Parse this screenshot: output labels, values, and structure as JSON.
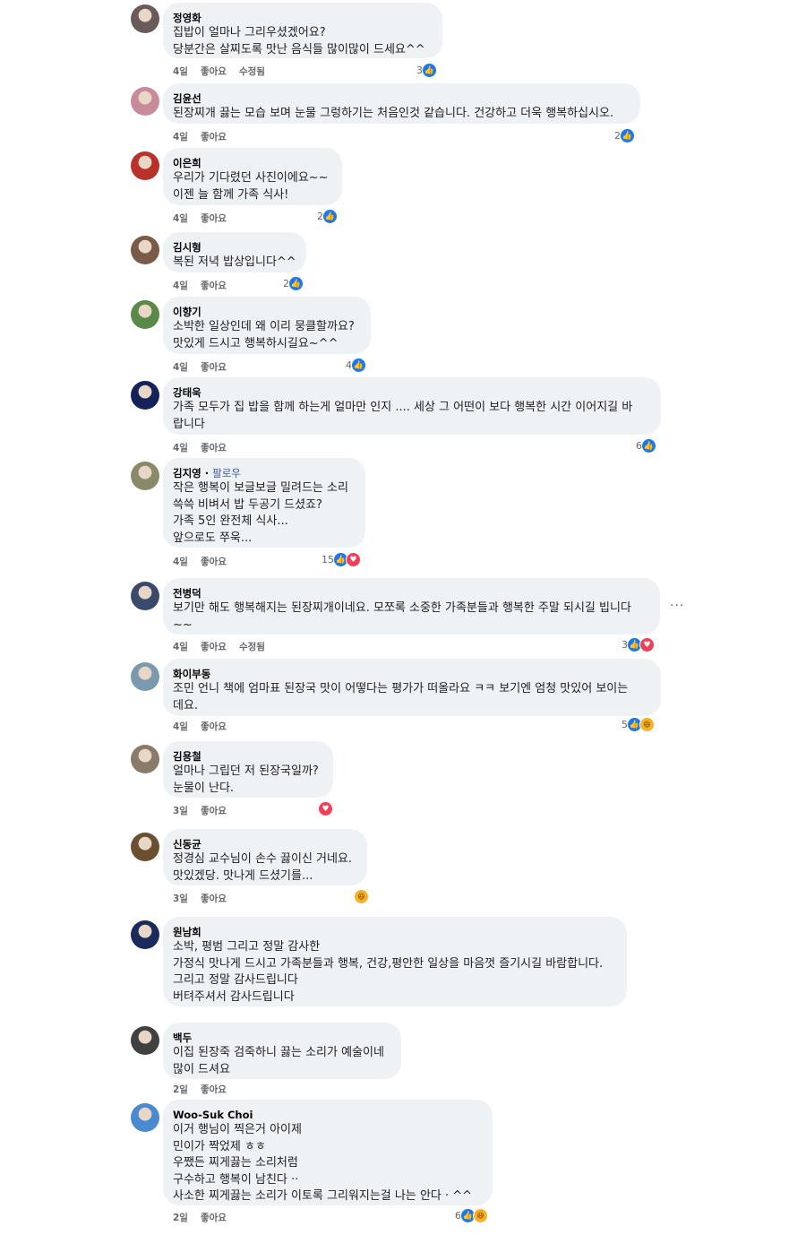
{
  "labels": {
    "like": "좋아요",
    "edited": "수정됨",
    "follow": "팔로우",
    "more": "···"
  },
  "comments": [
    {
      "author": "정영화",
      "lines": [
        "집밥이 얼마나 그리우셨겠어요?",
        "당분간은 살찌도록 맛난 음식들 많이많이 드세요^^"
      ],
      "time": "4일",
      "edited": true,
      "reaction_count": "3",
      "reactions": [
        "like"
      ],
      "avatar_color": "#6a5a5a"
    },
    {
      "author": "김윤선",
      "lines": [
        "된장찌개 끓는 모습 보며 눈물 그렁하기는 처음인것 같습니다. 건강하고 더욱 행복하십시오."
      ],
      "time": "4일",
      "edited": false,
      "reaction_count": "2",
      "reactions": [
        "like"
      ],
      "avatar_color": "#c98a9a"
    },
    {
      "author": "이은희",
      "lines": [
        "우리가 기다렸던 사진이에요~~",
        "이젠 늘 함께 가족 식사!"
      ],
      "time": "4일",
      "edited": false,
      "reaction_count": "2",
      "reactions": [
        "like"
      ],
      "avatar_color": "#b8322a"
    },
    {
      "author": "김시형",
      "lines": [
        "복된 저녁 밥상입니다^^"
      ],
      "time": "4일",
      "edited": false,
      "reaction_count": "2",
      "reactions": [
        "like"
      ],
      "avatar_color": "#7a5a48"
    },
    {
      "author": "이향기",
      "lines": [
        "소박한 일상인데 왜 이리 뭉클할까요?",
        "맛있게 드시고 행복하시길요~^^"
      ],
      "time": "4일",
      "edited": false,
      "reaction_count": "4",
      "reactions": [
        "like"
      ],
      "avatar_color": "#5a8a4a"
    },
    {
      "author": "강태욱",
      "lines": [
        "가족 모두가 집 밥을 함께 하는게 얼마만 인지 .... 세상 그 어떤이 보다 행복한 시간 이어지길 바",
        "랍니다"
      ],
      "time": "4일",
      "edited": false,
      "reaction_count": "6",
      "reactions": [
        "like"
      ],
      "avatar_color": "#15225a"
    },
    {
      "author": "김지영",
      "follow": true,
      "lines": [
        "작은 행복이 보글보글 밀려드는 소리",
        "쓱쓱 비벼서 밥 두공기 드셨죠?",
        "가족 5인 완전체 식사...",
        "앞으로도 쭈욱..."
      ],
      "time": "4일",
      "edited": false,
      "reaction_count": "15",
      "reactions": [
        "like",
        "love"
      ],
      "avatar_color": "#8a8a6a"
    },
    {
      "author": "전병덕",
      "lines": [
        "보기만 해도 행복해지는 된장찌개이네요. 모쪼록 소중한 가족분들과 행복한 주말 되시길 빕니다",
        "~~"
      ],
      "time": "4일",
      "edited": true,
      "reaction_count": "3",
      "reactions": [
        "like",
        "love"
      ],
      "avatar_color": "#3a4a6a",
      "more": true
    },
    {
      "author": "화이부동",
      "lines": [
        "조민 언니 책에 엄마표 된장국 맛이 어떻다는 평가가 떠올라요 ㅋㅋ 보기엔 엄청 맛있어 보이는",
        "데요."
      ],
      "time": "4일",
      "edited": false,
      "reaction_count": "5",
      "reactions": [
        "like",
        "haha"
      ],
      "avatar_color": "#7a9ab0"
    },
    {
      "author": "김용철",
      "lines": [
        "얼마나 그립던 저 된장국일까?",
        "눈물이 난다."
      ],
      "time": "3일",
      "edited": false,
      "reaction_count": "",
      "reactions": [
        "love"
      ],
      "avatar_color": "#8a7a6a"
    },
    {
      "author": "신동균",
      "lines": [
        "정경심 교수님이 손수 끓이신 거네요.",
        "맛있겠당. 맛나게 드셨기를..."
      ],
      "time": "3일",
      "edited": false,
      "reaction_count": "",
      "reactions": [
        "haha"
      ],
      "avatar_color": "#6a5030"
    },
    {
      "author": "원남희",
      "lines": [
        "소박, 평범 그리고 정말 감사한",
        "가정식 맛나게 드시고 가족분들과 행복, 건강,평안한 일상을 마음껏 즐기시길 바람합니다.",
        "그리고 정말 감사드립니다",
        "버텨주셔서 감사드립니다"
      ],
      "time": "",
      "edited": false,
      "reaction_count": "",
      "reactions": [],
      "avatar_color": "#1a2a5a"
    },
    {
      "author": "백두",
      "lines": [
        "이집 된장죽 검죽하니 끓는 소리가 예술이네",
        "많이 드셔요"
      ],
      "time": "2일",
      "edited": false,
      "reaction_count": "",
      "reactions": [],
      "avatar_color": "#404040"
    },
    {
      "author": "Woo-Suk Choi",
      "lines": [
        "이거 행님이 찍은거 아이제",
        "민이가 짝었제 ㅎㅎ",
        "우쨌든 찌게끓는 소리처럼",
        "구수하고 행복이 남친다 ··",
        "사소한 찌게끓는 소리가 이토록 그리워지는걸 나는 안다 · ^^"
      ],
      "time": "2일",
      "edited": false,
      "reaction_count": "6",
      "reactions": [
        "like",
        "haha"
      ],
      "avatar_color": "#4a8ad0"
    }
  ]
}
